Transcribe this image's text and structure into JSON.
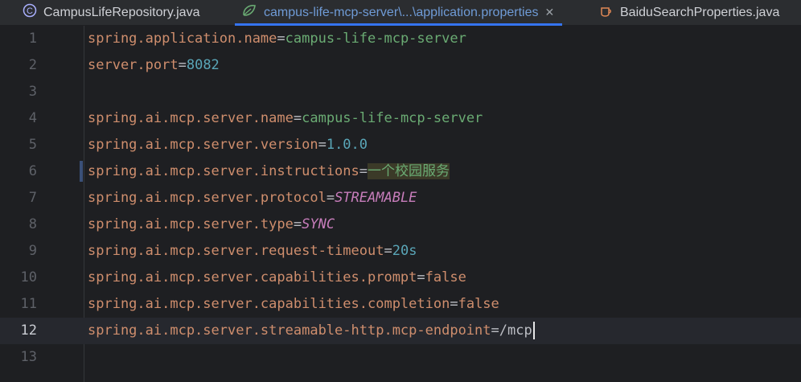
{
  "tabs": [
    {
      "label": "CampusLifeRepository.java",
      "icon": "class-c-icon",
      "active": false
    },
    {
      "label": "campus-life-mcp-server\\...\\application.properties",
      "icon": "spring-leaf-icon",
      "active": true
    },
    {
      "label": "BaiduSearchProperties.java",
      "icon": "java-cup-icon",
      "active": false
    }
  ],
  "close_glyph": "✕",
  "lines": [
    {
      "n": "1",
      "key": "spring.application.name",
      "eq": "=",
      "val": "campus-life-mcp-server"
    },
    {
      "n": "2",
      "key": "server.port",
      "eq": "=",
      "val": "8082"
    },
    {
      "n": "3",
      "key": "",
      "eq": "",
      "val": ""
    },
    {
      "n": "4",
      "key": "spring.ai.mcp.server.name",
      "eq": "=",
      "val": "campus-life-mcp-server"
    },
    {
      "n": "5",
      "key": "spring.ai.mcp.server.version",
      "eq": "=",
      "val": "1.0.0"
    },
    {
      "n": "6",
      "key": "spring.ai.mcp.server.instructions",
      "eq": "=",
      "val": "一个校园服务"
    },
    {
      "n": "7",
      "key": "spring.ai.mcp.server.protocol",
      "eq": "=",
      "val": "STREAMABLE"
    },
    {
      "n": "8",
      "key": "spring.ai.mcp.server.type",
      "eq": "=",
      "val": "SYNC"
    },
    {
      "n": "9",
      "key": "spring.ai.mcp.server.request-timeout",
      "eq": "=",
      "val": "20s"
    },
    {
      "n": "10",
      "key": "spring.ai.mcp.server.capabilities.prompt",
      "eq": "=",
      "val": "false"
    },
    {
      "n": "11",
      "key": "spring.ai.mcp.server.capabilities.completion",
      "eq": "=",
      "val": "false"
    },
    {
      "n": "12",
      "key": "spring.ai.mcp.server.streamable-http.mcp-endpoint",
      "eq": "=",
      "val": "/mcp"
    },
    {
      "n": "13",
      "key": "",
      "eq": "",
      "val": ""
    }
  ]
}
